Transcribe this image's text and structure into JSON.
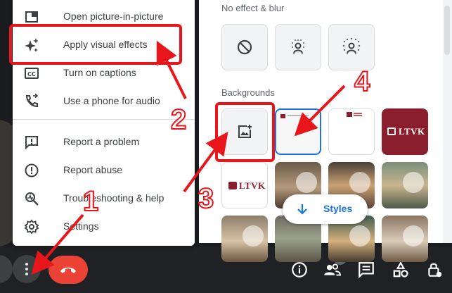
{
  "menu": {
    "items": [
      {
        "label": "Open picture-in-picture",
        "icon": "picture-in-picture-icon"
      },
      {
        "label": "Apply visual effects",
        "icon": "sparkle-icon"
      },
      {
        "label": "Turn on captions",
        "icon": "captions-icon"
      },
      {
        "label": "Use a phone for audio",
        "icon": "phone-audio-icon"
      },
      {
        "label": "Report a problem",
        "icon": "report-problem-icon"
      },
      {
        "label": "Report abuse",
        "icon": "report-abuse-icon"
      },
      {
        "label": "Troubleshooting & help",
        "icon": "troubleshooting-icon"
      },
      {
        "label": "Settings",
        "icon": "gear-icon"
      }
    ]
  },
  "effects": {
    "blur_section_title": "No effect & blur",
    "backgrounds_section_title": "Backgrounds",
    "blur_options": [
      "no-effect-icon",
      "slight-blur-icon",
      "blur-icon"
    ],
    "styles_button_label": "Styles",
    "ltvk_brand": "LTVK",
    "selected_background_index": 1
  },
  "annotations": {
    "numbers": [
      "1",
      "2",
      "3",
      "4"
    ],
    "color": "#e8151b"
  },
  "bottom_bar": {
    "participants_count": "1",
    "icons": [
      "more-options-icon",
      "end-call-icon",
      "info-icon",
      "people-icon",
      "chat-icon",
      "activities-icon",
      "host-controls-icon"
    ]
  },
  "colors": {
    "accent": "#1a73e8",
    "end_call": "#ea4335",
    "background": "#202124",
    "ltvk_maroon": "#8b1e2d"
  }
}
